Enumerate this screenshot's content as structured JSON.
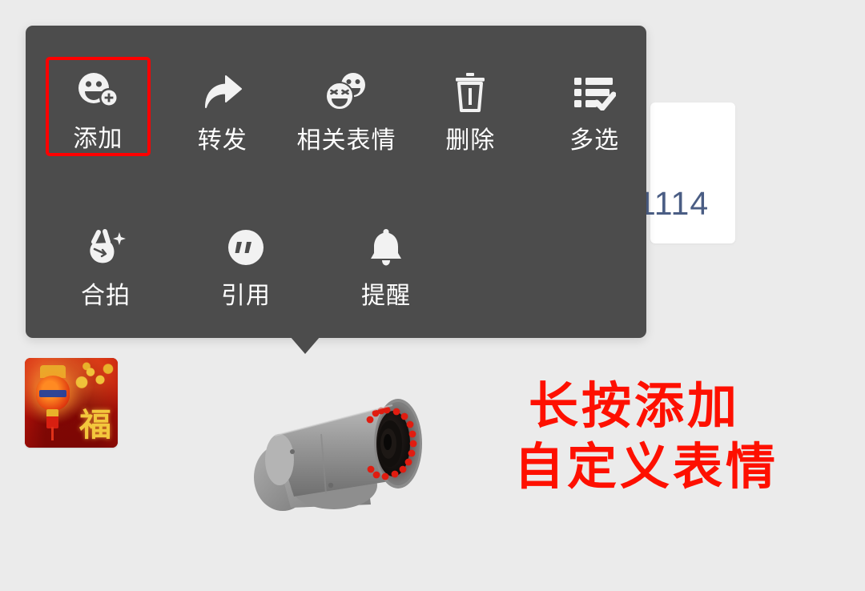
{
  "app": {
    "background_color": "#ebebeb",
    "menu_background_color": "#4c4c4c",
    "highlight_color": "#fe0000",
    "annotation_color": "#fe1000",
    "label_color": "#ffffff"
  },
  "chat": {
    "bubble_number": "1114",
    "bubble_number_color": "#4a5d84"
  },
  "context_menu": {
    "rows": [
      {
        "items": [
          {
            "label": "添加",
            "icon": "emoji-add-icon",
            "highlighted": true
          },
          {
            "label": "转发",
            "icon": "forward-arrow-icon",
            "highlighted": false
          },
          {
            "label": "相关表情",
            "icon": "related-emoji-icon",
            "highlighted": false
          },
          {
            "label": "删除",
            "icon": "trash-icon",
            "highlighted": false
          },
          {
            "label": "多选",
            "icon": "multi-select-list-icon",
            "highlighted": false
          }
        ]
      },
      {
        "items": [
          {
            "label": "合拍",
            "icon": "peace-hand-sparkle-icon",
            "highlighted": false
          },
          {
            "label": "引用",
            "icon": "quote-circle-icon",
            "highlighted": false
          },
          {
            "label": "提醒",
            "icon": "bell-icon",
            "highlighted": false
          }
        ]
      }
    ]
  },
  "sticker": {
    "name": "chinese-new-year-lantern-sticker",
    "character": "福"
  },
  "photo": {
    "name": "cctv-security-camera-photo"
  },
  "annotation": {
    "line1": "长按添加",
    "line2": "自定义表情"
  }
}
